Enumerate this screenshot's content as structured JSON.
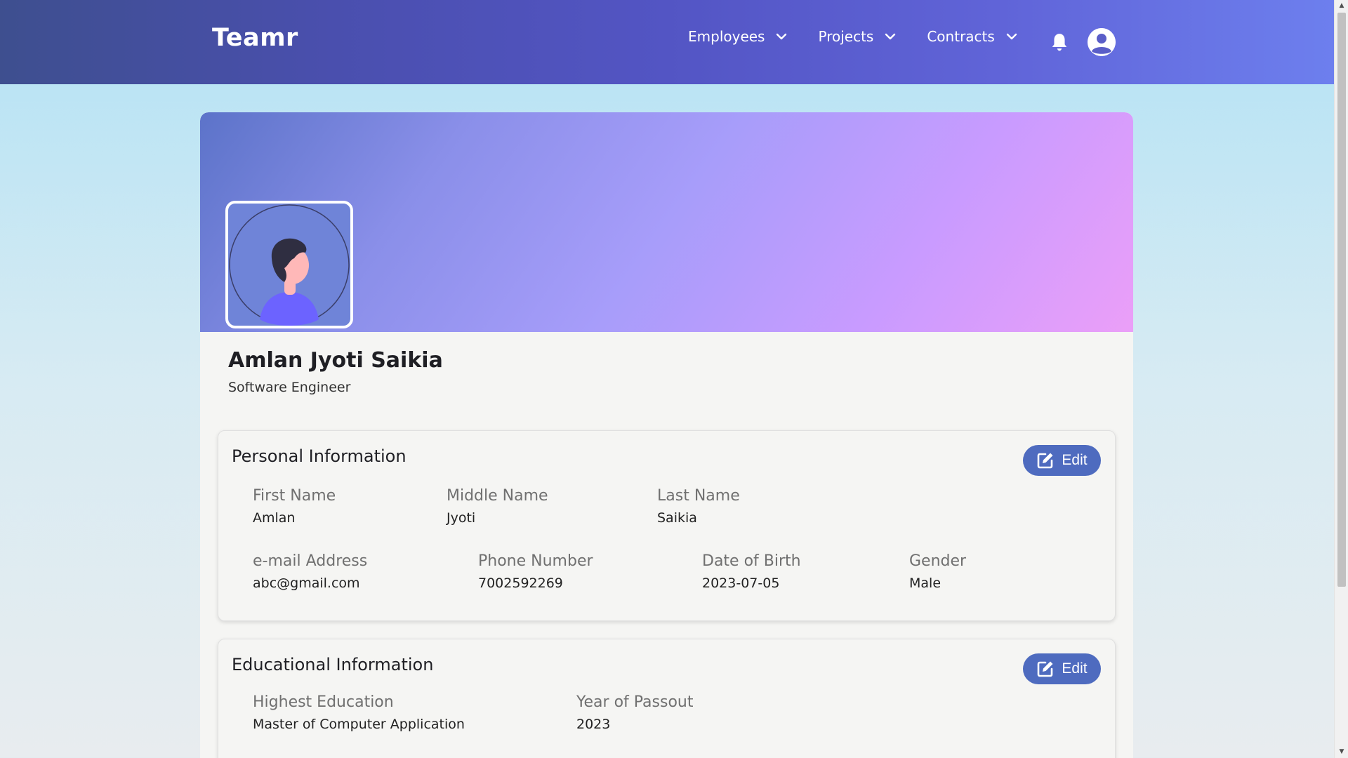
{
  "app": {
    "brand": "Teamr"
  },
  "nav": {
    "items": [
      {
        "label": "Employees"
      },
      {
        "label": "Projects"
      },
      {
        "label": "Contracts"
      }
    ],
    "notifications_icon": "bell-icon",
    "account_icon": "user-circle-icon"
  },
  "profile": {
    "name": "Amlan Jyoti Saikia",
    "role": "Software Engineer"
  },
  "personal": {
    "title": "Personal Information",
    "edit_label": "Edit",
    "first_name_label": "First Name",
    "first_name": "Amlan",
    "middle_name_label": "Middle Name",
    "middle_name": "Jyoti",
    "last_name_label": "Last Name",
    "last_name": "Saikia",
    "email_label": "e-mail Address",
    "email": "abc@gmail.com",
    "phone_label": "Phone Number",
    "phone": "7002592269",
    "dob_label": "Date of Birth",
    "dob": "2023-07-05",
    "gender_label": "Gender",
    "gender": "Male"
  },
  "education": {
    "title": "Educational Information",
    "edit_label": "Edit",
    "highest_label": "Highest Education",
    "highest": "Master of Computer Application",
    "year_label": "Year of Passout",
    "year": "2023"
  },
  "colors": {
    "navbar_start": "#3e4f8f",
    "navbar_end": "#6d7fee",
    "edit_button": "#4e6bbf",
    "cover_start": "#5c73c9",
    "cover_end": "#eb9ff8"
  }
}
